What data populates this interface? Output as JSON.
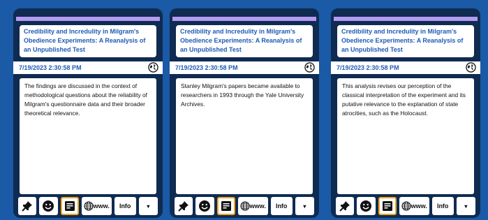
{
  "cards": [
    {
      "title": "Credibility and Incredulity in Milgram's Obedience Experiments: A Reanalysis of an Unpublished Test",
      "date": "7/19/2023 2:30:58 PM",
      "body": "The findings are discussed in the context of methodological questions about the reliability of Milgram's questionnaire data and their broader theoretical relevance."
    },
    {
      "title": "Credibility and Incredulity in Milgram's Obedience Experiments: A Reanalysis of an Unpublished Test",
      "date": "7/19/2023 2:30:58 PM",
      "body": "Stanley Milgram's papers became available to researchers in 1993 through the Yale University Archives."
    },
    {
      "title": "Credibility and Incredulity in Milgram's Obedience Experiments: A Reanalysis of an Unpublished Test",
      "date": "7/19/2023 2:30:58 PM",
      "body": "This analysis revises our perception of the classical interpretation of the experiment and its putative relevance to the explanation of state atrocities, such as the Holocaust."
    }
  ],
  "toolbar": {
    "www_label": "www.",
    "info_label": "Info",
    "more_label": "▾"
  },
  "icons": [
    "pin-icon",
    "smiley-icon",
    "notes-icon",
    "globe-icon",
    "chevron-down-icon"
  ],
  "colors": {
    "background": "#1a5aa6",
    "card": "#0f2b52",
    "accent_bar": "#b59bf2",
    "title_text": "#1f5bb5",
    "notes_highlight": "#f2a81b"
  }
}
